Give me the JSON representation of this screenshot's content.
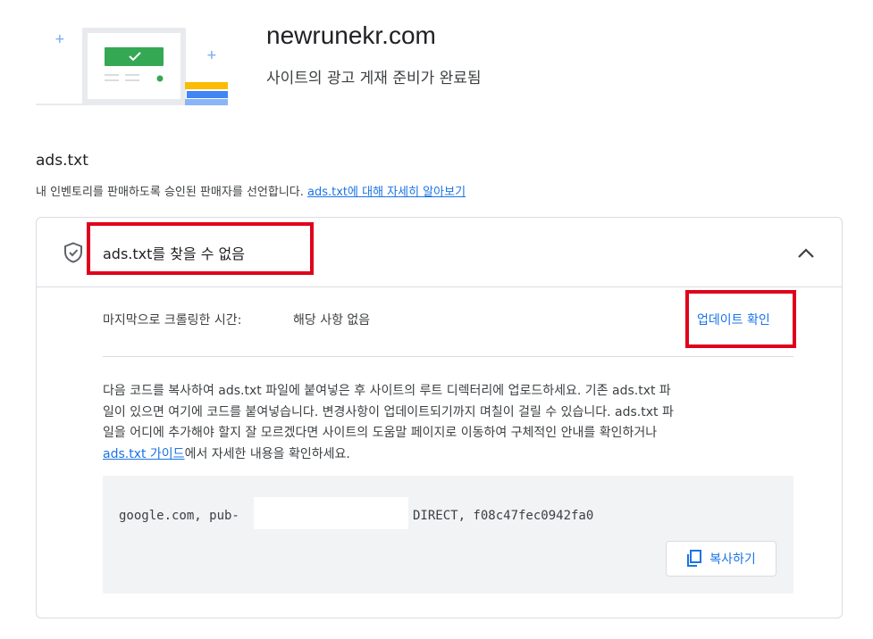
{
  "site": {
    "domain": "newrunekr.com",
    "status": "사이트의 광고 게재 준비가 완료됨"
  },
  "section": {
    "title": "ads.txt",
    "description": "내 인벤토리를 판매하도록 승인된 판매자를 선언합니다.",
    "learn_more_link": "ads.txt에 대해 자세히 알아보기"
  },
  "card": {
    "header_title_bold": "ads.txt",
    "header_title_rest": "를 찾을 수 없음",
    "crawl_label": "마지막으로 크롤링한 시간:",
    "crawl_value": "해당 사항 없음",
    "check_update": "업데이트 확인",
    "instructions": {
      "line1": "다음 코드를 복사하여 ads.txt 파일에 붙여넣은 후 사이트의 루트 디렉터리에 업로드하세요. 기존 ads.txt 파",
      "line2": "일이 있으면 여기에 코드를 붙여넣습니다. 변경사항이 업데이트되기까지 며칠이 걸릴 수 있습니다. ads.txt 파",
      "line3": "일을 어디에 추가해야 할지 잘 모르겠다면 사이트의 도움말 페이지로 이동하여 구체적인 안내를 확인하거나",
      "guide_link": "ads.txt 가이드",
      "line4_rest": "에서 자세한 내용을 확인하세요."
    },
    "code": {
      "prefix": "google.com, pub-",
      "suffix": "DIRECT, f08c47fec0942fa0"
    },
    "copy_button": "복사하기"
  },
  "colors": {
    "accent": "#1a73e8",
    "highlight": "#e0001b",
    "success": "#34a853",
    "code_bg": "#f1f3f4"
  }
}
